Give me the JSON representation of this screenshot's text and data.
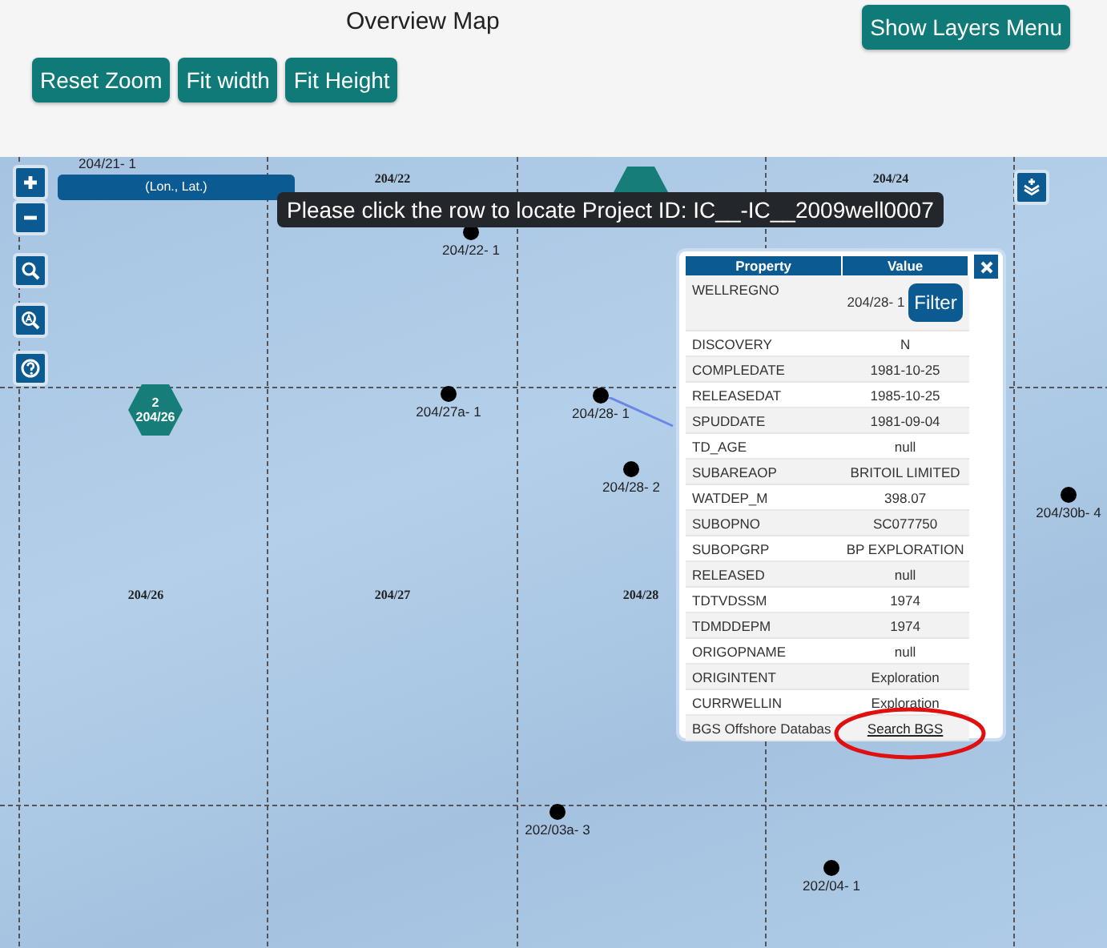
{
  "header": {
    "title": "Overview Map",
    "buttons": [
      "Reset Zoom",
      "Fit width",
      "Fit Height"
    ],
    "layers_button": "Show Layers Menu"
  },
  "map": {
    "coordinates_label": "(Lon., Lat.)",
    "tooltip": "Please click the row to locate Project ID: IC__-IC__2009well0007",
    "block_labels": [
      "204/22",
      "204/24",
      "204/26",
      "204/27",
      "204/28"
    ],
    "wells": [
      "204/21- 1",
      "204/22- 1",
      "204/27a- 1",
      "204/28- 1",
      "204/28- 2",
      "204/30b- 4",
      "202/03a- 3",
      "202/04- 1"
    ],
    "clusters": [
      {
        "kind": "labeled",
        "count": "2",
        "label": "204/26"
      },
      {
        "kind": "covered"
      }
    ]
  },
  "popup": {
    "columns": [
      "Property",
      "Value"
    ],
    "rows": [
      {
        "kind": "filter",
        "property": "WELLREGNO",
        "value": "204/28- 1",
        "action": "Filter"
      },
      {
        "kind": "text",
        "property": "DISCOVERY",
        "value": "N"
      },
      {
        "kind": "text",
        "property": "COMPLEDATE",
        "value": "1981-10-25"
      },
      {
        "kind": "text",
        "property": "RELEASEDAT",
        "value": "1985-10-25"
      },
      {
        "kind": "text",
        "property": "SPUDDATE",
        "value": "1981-09-04"
      },
      {
        "kind": "text",
        "property": "TD_AGE",
        "value": "null"
      },
      {
        "kind": "text",
        "property": "SUBAREAOP",
        "value": "BRITOIL LIMITED"
      },
      {
        "kind": "text",
        "property": "WATDEP_M",
        "value": "398.07"
      },
      {
        "kind": "text",
        "property": "SUBOPNO",
        "value": "SC077750"
      },
      {
        "kind": "text",
        "property": "SUBOPGRP",
        "value": "BP EXPLORATION"
      },
      {
        "kind": "text",
        "property": "RELEASED",
        "value": "null"
      },
      {
        "kind": "text",
        "property": "TDTVDSSM",
        "value": "1974"
      },
      {
        "kind": "text",
        "property": "TDMDDEPM",
        "value": "1974"
      },
      {
        "kind": "text",
        "property": "ORIGOPNAME",
        "value": "null"
      },
      {
        "kind": "text",
        "property": "ORIGINTENT",
        "value": "Exploration"
      },
      {
        "kind": "text",
        "property": "CURRWELLIN",
        "value": "Exploration"
      },
      {
        "kind": "link",
        "property": "BGS Offshore Databas",
        "value": "Search BGS"
      }
    ]
  }
}
